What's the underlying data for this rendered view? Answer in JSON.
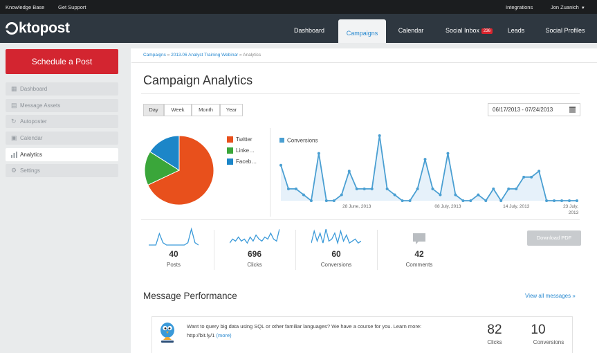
{
  "topbar": {
    "left_links": [
      "Knowledge Base",
      "Get Support"
    ],
    "integrations": "Integrations",
    "user": "Jon Zuanich"
  },
  "brand": {
    "logo_text": "ktopost"
  },
  "nav": {
    "items": [
      {
        "label": "Dashboard"
      },
      {
        "label": "Campaigns",
        "active": true
      },
      {
        "label": "Calendar"
      },
      {
        "label": "Social Inbox",
        "badge": "236"
      },
      {
        "label": "Leads"
      },
      {
        "label": "Social Profiles"
      }
    ]
  },
  "sidebar": {
    "schedule_button": "Schedule a Post",
    "items": [
      {
        "label": "Dashboard",
        "icon": "grid-icon"
      },
      {
        "label": "Message Assets",
        "icon": "database-icon"
      },
      {
        "label": "Autoposter",
        "icon": "refresh-icon"
      },
      {
        "label": "Calendar",
        "icon": "calendar-icon"
      },
      {
        "label": "Analytics",
        "icon": "bar-chart-icon",
        "active": true
      },
      {
        "label": "Settings",
        "icon": "gear-icon"
      }
    ]
  },
  "breadcrumb": {
    "root": "Campaigns",
    "campaign": "2013.06 Analyst Training Webinar",
    "current": "Analytics",
    "sep": "»"
  },
  "page_title": "Campaign Analytics",
  "periods": [
    "Day",
    "Week",
    "Month",
    "Year"
  ],
  "date_range": "06/17/2013 - 07/24/2013",
  "pie_legend": [
    {
      "label": "Twitter",
      "color": "#e8501c"
    },
    {
      "label": "Linke…",
      "color": "#3aa63a"
    },
    {
      "label": "Faceb…",
      "color": "#1c86c8"
    }
  ],
  "chart_data": [
    {
      "type": "pie",
      "slices": [
        {
          "label": "Twitter",
          "value": 68,
          "color": "#e8501c"
        },
        {
          "label": "Linke…",
          "value": 16,
          "color": "#3aa63a"
        },
        {
          "label": "Faceb…",
          "value": 16,
          "color": "#1c86c8"
        }
      ]
    },
    {
      "type": "area",
      "legend": "Conversions",
      "color": "#4a9fd2",
      "x_ticks": [
        "28 June, 2013",
        "08 July, 2013",
        "14 July, 2013",
        "23 July, 2013"
      ],
      "values": [
        6,
        2,
        2,
        1,
        0,
        8,
        0,
        0,
        1,
        5,
        2,
        2,
        2,
        11,
        2,
        1,
        0,
        0,
        2,
        7,
        2,
        1,
        8,
        1,
        0,
        0,
        1,
        0,
        2,
        0,
        2,
        2,
        4,
        4,
        5,
        0,
        0,
        0,
        0,
        0
      ],
      "ylim": [
        0,
        11
      ]
    }
  ],
  "stats": [
    {
      "value": "40",
      "label": "Posts",
      "spark": [
        0,
        0,
        0,
        5,
        1,
        0,
        0,
        0,
        0,
        0,
        0,
        1,
        7,
        1,
        0
      ]
    },
    {
      "value": "696",
      "label": "Clicks",
      "spark": [
        1,
        3,
        2,
        4,
        2,
        3,
        1,
        4,
        2,
        5,
        3,
        2,
        4,
        3,
        6,
        3,
        2,
        8
      ]
    },
    {
      "value": "60",
      "label": "Conversions",
      "spark": [
        1,
        7,
        2,
        6,
        1,
        8,
        2,
        3,
        6,
        1,
        7,
        2,
        5,
        1,
        2,
        3,
        1,
        2
      ]
    },
    {
      "value": "42",
      "label": "Comments"
    }
  ],
  "download_pdf": "Download PDF",
  "message_performance": {
    "title": "Message Performance",
    "view_all": "View all messages »",
    "message": {
      "text": "Want to query big data using SQL or other familiar languages? We have a course for you. Learn more:",
      "link": "http://bit.ly/1",
      "more": "(more)",
      "clicks_value": "82",
      "clicks_label": "Clicks",
      "conversions_value": "10",
      "conversions_label": "Conversions"
    }
  }
}
